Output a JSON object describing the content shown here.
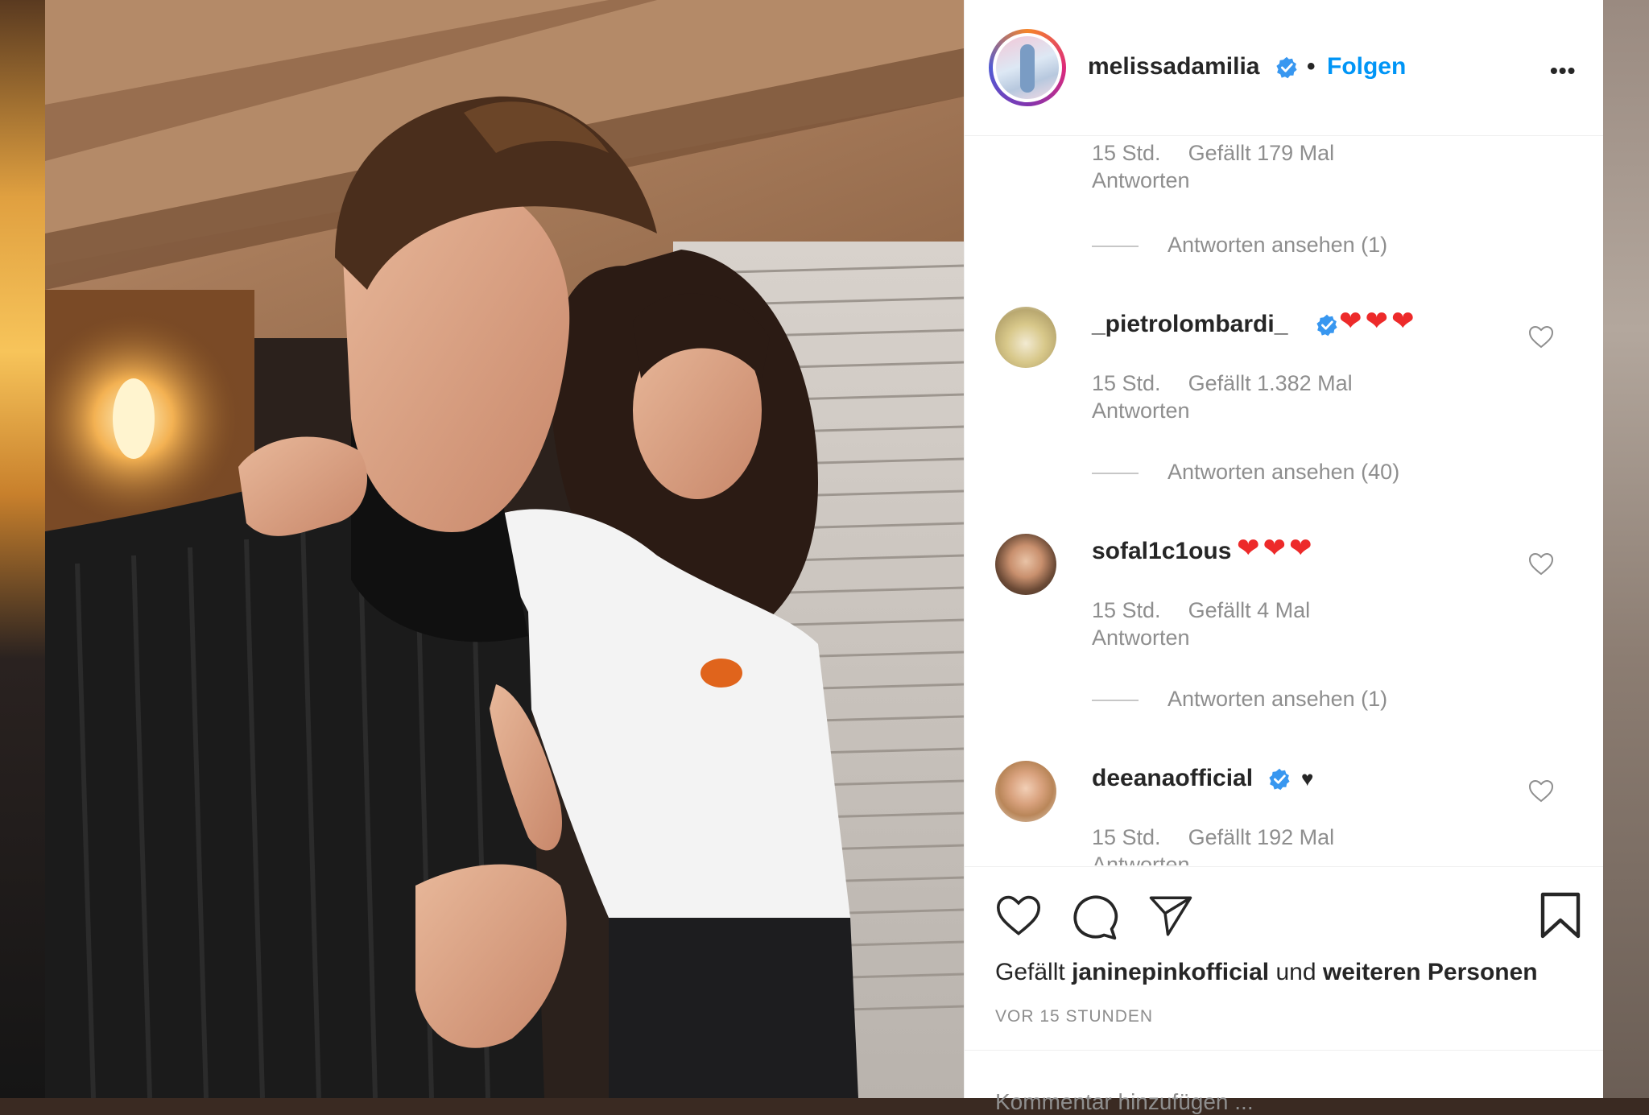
{
  "post": {
    "username": "melissadamilia",
    "separator": "•",
    "follow_label": "Folgen",
    "more_label": "•••"
  },
  "comments": [
    {
      "partial": true,
      "time": "15 Std.",
      "likes": "Gefällt 179 Mal",
      "reply_label": "Antworten",
      "view_replies": "Antworten ansehen (1)"
    },
    {
      "username": "_pietrolombardi_",
      "verified": true,
      "text": "❤❤❤",
      "time": "15 Std.",
      "likes": "Gefällt 1.382 Mal",
      "reply_label": "Antworten",
      "view_replies": "Antworten ansehen (40)"
    },
    {
      "username": "sofal1c1ous",
      "verified": false,
      "text": "❤❤❤",
      "time": "15 Std.",
      "likes": "Gefällt 4 Mal",
      "reply_label": "Antworten",
      "view_replies": "Antworten ansehen (1)"
    },
    {
      "username": "deeanaofficial",
      "verified": true,
      "text": "♥",
      "time": "15 Std.",
      "likes": "Gefällt 192 Mal",
      "reply_label": "Antworten"
    }
  ],
  "footer": {
    "liked_by_prefix": "Gefällt",
    "liked_by_user": "janinepinkofficial",
    "liked_by_middle": "und",
    "liked_by_rest": "weiteren Personen",
    "time_ago": "VOR 15 STUNDEN",
    "comment_placeholder": "Kommentar hinzufügen ..."
  },
  "icons": {
    "like": "heart-outline-icon",
    "comment": "speech-bubble-icon",
    "share": "paper-plane-icon",
    "save": "bookmark-icon",
    "verified": "verified-badge-icon"
  },
  "colors": {
    "link_blue": "#0095f6",
    "verified_blue": "#3897f0",
    "heart_red": "#ed2a2a",
    "text_primary": "#262626",
    "text_secondary": "#8e8e8e"
  }
}
